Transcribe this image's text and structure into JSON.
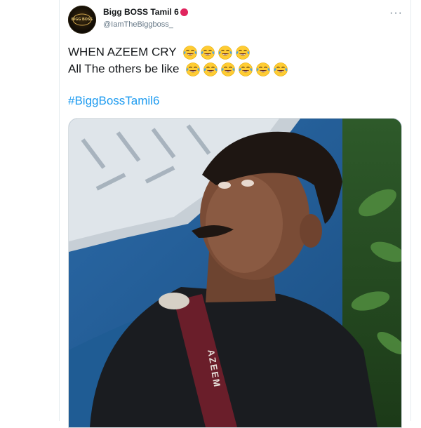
{
  "tweet": {
    "display_name": "Bigg BOSS Tamil 6",
    "handle": "@IamTheBiggboss_",
    "avatar_text": "BIGG BOSS",
    "more_icon": "more-horizontal-icon",
    "line1": "WHEN AZEEM CRY",
    "line1_emoji_count": 4,
    "line2": "All The others be like",
    "line2_emoji_count": 6,
    "emoji_name": "face-with-tears-of-joy",
    "hashtag": "#BiggBossTamil6",
    "media_strap_text": "AZEEM",
    "colors": {
      "name": "#14171a",
      "handle": "#657786",
      "hashtag": "#1d9bf0",
      "red_badge": "#e0245e"
    }
  }
}
